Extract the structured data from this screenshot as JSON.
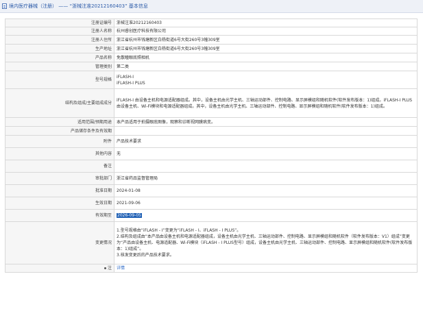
{
  "header": {
    "title": "境内医疗器械（注册） —— “浙械注准20212160403” 基本信息"
  },
  "rows": [
    {
      "label": "注册证编号",
      "value": "浙械注准20212160403"
    },
    {
      "label": "注册人名称",
      "value": "杭州睿创医疗科技有限公司"
    },
    {
      "label": "注册人住所",
      "value": "浙江省杭州市钱塘新区白杨街道6号大街260号3幢309室"
    },
    {
      "label": "生产地址",
      "value": "浙江省杭州市钱塘新区白杨街道6号大街260号3幢309室"
    },
    {
      "label": "产品名称",
      "value": "免散瞳眼底照相机"
    },
    {
      "label": "管理类别",
      "value": "第二类"
    },
    {
      "label": "型号规格",
      "lines": [
        "iFLASH-I",
        "iFLASH-I PLUS"
      ]
    },
    {
      "label": "结构及组成/主要组成成分",
      "value": "iFLASH-I 由设备主机和电源适配器组成。其中，设备主机由光学主机、三轴运动部件、控制电路、显示屏模组和随机软件(软件发布版本：1)组成。iFLASH-I PLUS 由设备主机、Wi-Fi模块和电源适配器组成。其中，设备主机由光学主机、三轴运动部件、控制电路、显示屏模组和随机软件(软件发布版本：1)组成。"
    },
    {
      "label": "适用范围/预期用途",
      "value": "本产品适用于拍摄眼底图像，观察和诊断视网膜病变。"
    },
    {
      "label": "产品储存条件及有效期",
      "value": ""
    },
    {
      "label": "附件",
      "value": "产品技术要求"
    },
    {
      "label": "其他内容",
      "value": "无"
    },
    {
      "label": "备注",
      "value": ""
    },
    {
      "label": "审批部门",
      "value": "浙江省药品监督管理局"
    },
    {
      "label": "批准日期",
      "value": "2024-01-08"
    },
    {
      "label": "生效日期",
      "value": "2021-09-06"
    },
    {
      "label": "有效期至",
      "value": "2026-09-05"
    },
    {
      "label": "变更情况",
      "lines": [
        "1.型号规格由“iFLASH - I”变更为“iFLASH - I、iFLASH - I PLUS”。",
        "2.结构及组成由“本产品由设备主机和电源适配器组成，设备主机由光学主机、三轴运动部件、控制电路、显示屏模组和随机软件（软件发布版本：V1）组成”变更为“产品由设备主机、电源适配器、Wi-Fi模块（iFLASH - I PLUS型号）组成，设备主机由光学主机、三轴运动部件、控制电路、显示屏模组和随机软件(软件发布版本：1)组成”。",
        "3.核发变更后的产品技术要求。"
      ]
    },
    {
      "label": "注",
      "value": "详情"
    }
  ]
}
